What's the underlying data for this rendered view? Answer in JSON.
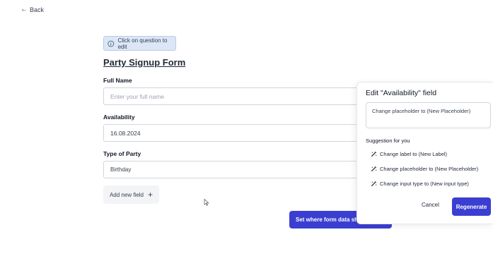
{
  "nav": {
    "back_label": "Back"
  },
  "hint": {
    "text": "Click on question to edit"
  },
  "form": {
    "title": "Party Signup Form",
    "fields": [
      {
        "label": "Full Name",
        "placeholder": "Enter your full name",
        "value": ""
      },
      {
        "label": "Availability",
        "value": "16.08.2024"
      },
      {
        "label": "Type of Party",
        "value": "Birthday"
      }
    ],
    "add_field_label": "Add new field",
    "submit_target_label": "Set where form data should go"
  },
  "edit_panel": {
    "title": "Edit \"Availability\" field",
    "prompt_value": "Change placeholder to (New Placeholder)",
    "suggestions_heading": "Suggestion for you",
    "suggestions": [
      "Change label to (New Label)",
      "Change placeholder to (New Placeholder)",
      "Change input type to (New input type)"
    ],
    "cancel_label": "Cancel",
    "regenerate_label": "Regenerate"
  },
  "colors": {
    "accent": "#3b3fd1",
    "hint_bg": "#dbe7f6"
  }
}
